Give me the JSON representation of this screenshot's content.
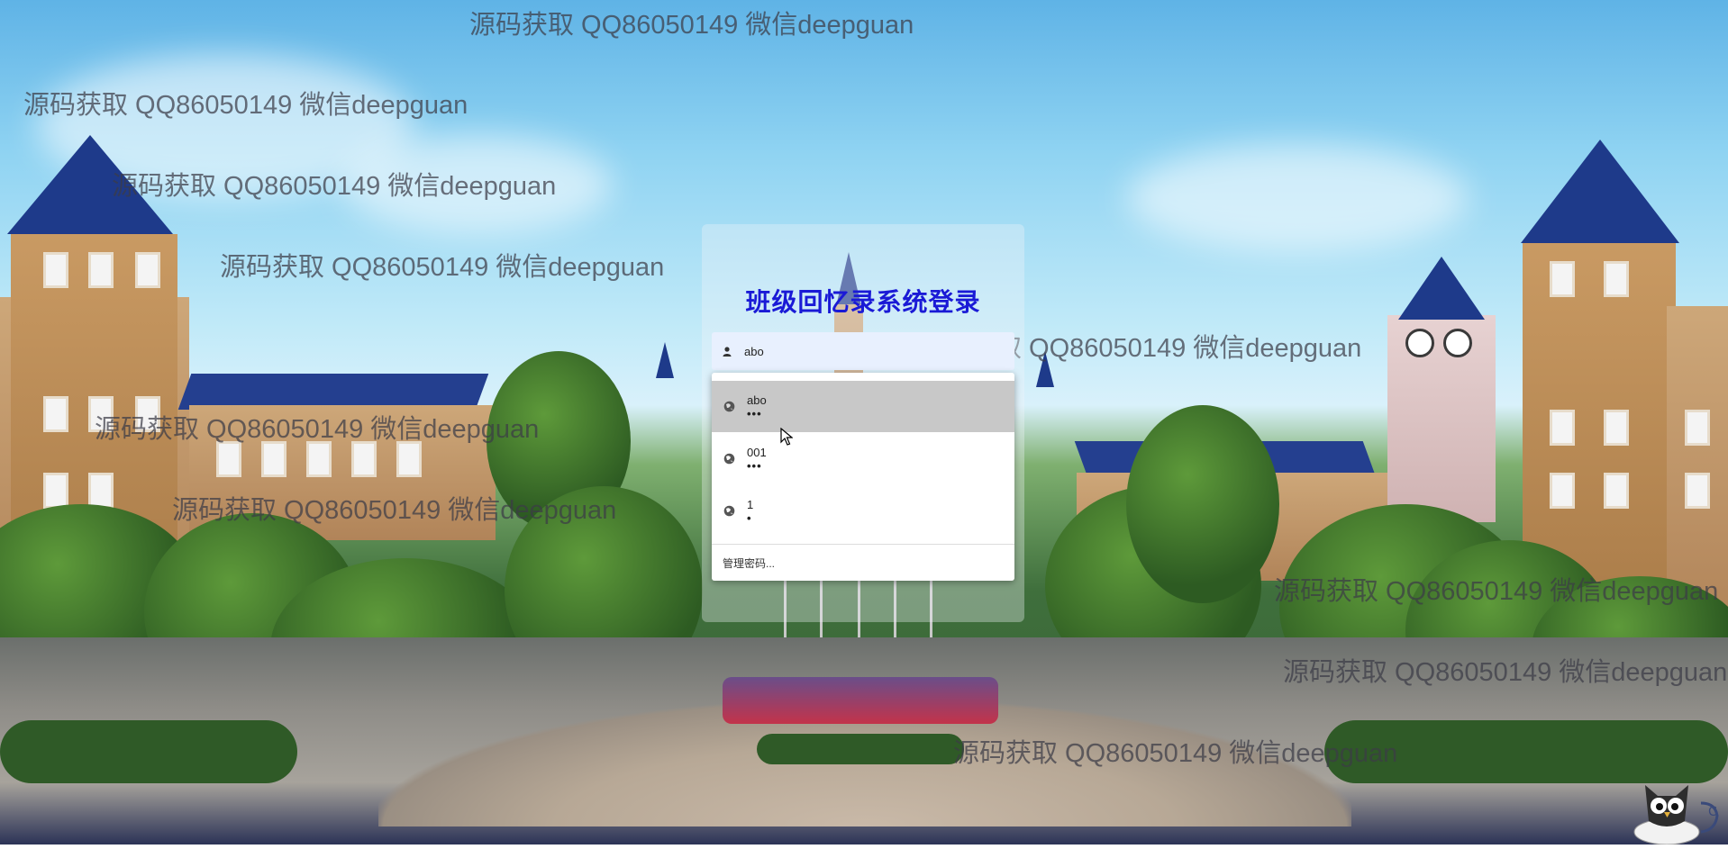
{
  "login": {
    "title": "班级回忆录系统登录",
    "username_value": "abo"
  },
  "autocomplete": {
    "items": [
      {
        "user": "abo",
        "pass": "•••",
        "selected": true
      },
      {
        "user": "001",
        "pass": "•••",
        "selected": false
      },
      {
        "user": "1",
        "pass": "•",
        "selected": false
      }
    ],
    "manage_label": "管理密码..."
  },
  "watermark": {
    "text": "源码获取 QQ86050149 微信deepguan"
  },
  "icons": {
    "user": "person-icon",
    "saved_password": "globe-icon",
    "pointer": "mouse-cursor-icon",
    "mascot": "owl-mascot-icon"
  },
  "colors": {
    "title": "#1a1ad6",
    "field_bg": "#e8f0fe",
    "selected_item_bg": "#c8c8c8"
  }
}
